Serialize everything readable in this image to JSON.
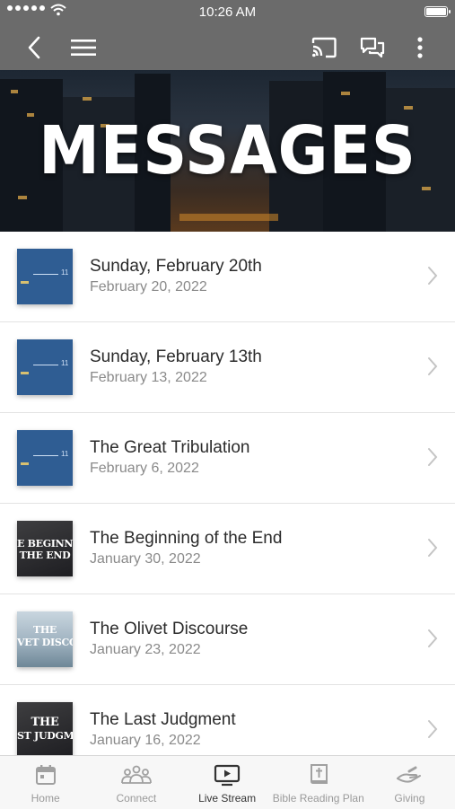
{
  "status_bar": {
    "time": "10:26 AM"
  },
  "nav": {
    "icons": [
      "back-icon",
      "menu-icon",
      "cast-icon",
      "chat-icon",
      "more-icon"
    ]
  },
  "hero": {
    "title": "MESSAGES"
  },
  "messages": [
    {
      "title": "Sunday, February 20th",
      "date": "February 20, 2022",
      "thumb_style": "blue",
      "thumb_number": "11"
    },
    {
      "title": "Sunday, February 13th",
      "date": "February 13, 2022",
      "thumb_style": "blue",
      "thumb_number": "11"
    },
    {
      "title": "The Great Tribulation",
      "date": "February 6, 2022",
      "thumb_style": "blue",
      "thumb_number": "11"
    },
    {
      "title": "The Beginning of the End",
      "date": "January 30, 2022",
      "thumb_style": "dark",
      "thumb_text": [
        "E BEGINNING",
        "THE END"
      ]
    },
    {
      "title": "The Olivet Discourse",
      "date": "January 23, 2022",
      "thumb_style": "mist",
      "thumb_text": [
        "THE",
        "VET DISCOU"
      ]
    },
    {
      "title": "The Last Judgment",
      "date": "January 16, 2022",
      "thumb_style": "dark",
      "thumb_text": [
        "THE",
        "ST JUDGM"
      ]
    }
  ],
  "tabs": [
    {
      "label": "Home",
      "icon": "calendar-icon",
      "active": false
    },
    {
      "label": "Connect",
      "icon": "people-icon",
      "active": false
    },
    {
      "label": "Live Stream",
      "icon": "tv-play-icon",
      "active": true
    },
    {
      "label": "Bible Reading Plan",
      "icon": "bible-icon",
      "active": false
    },
    {
      "label": "Giving",
      "icon": "giving-hand-icon",
      "active": false
    }
  ],
  "colors": {
    "bar": "#6b6b6b",
    "active_tab": "#333333",
    "inactive_tab": "#9a9a9a",
    "thumb_blue": "#2f5d93"
  }
}
